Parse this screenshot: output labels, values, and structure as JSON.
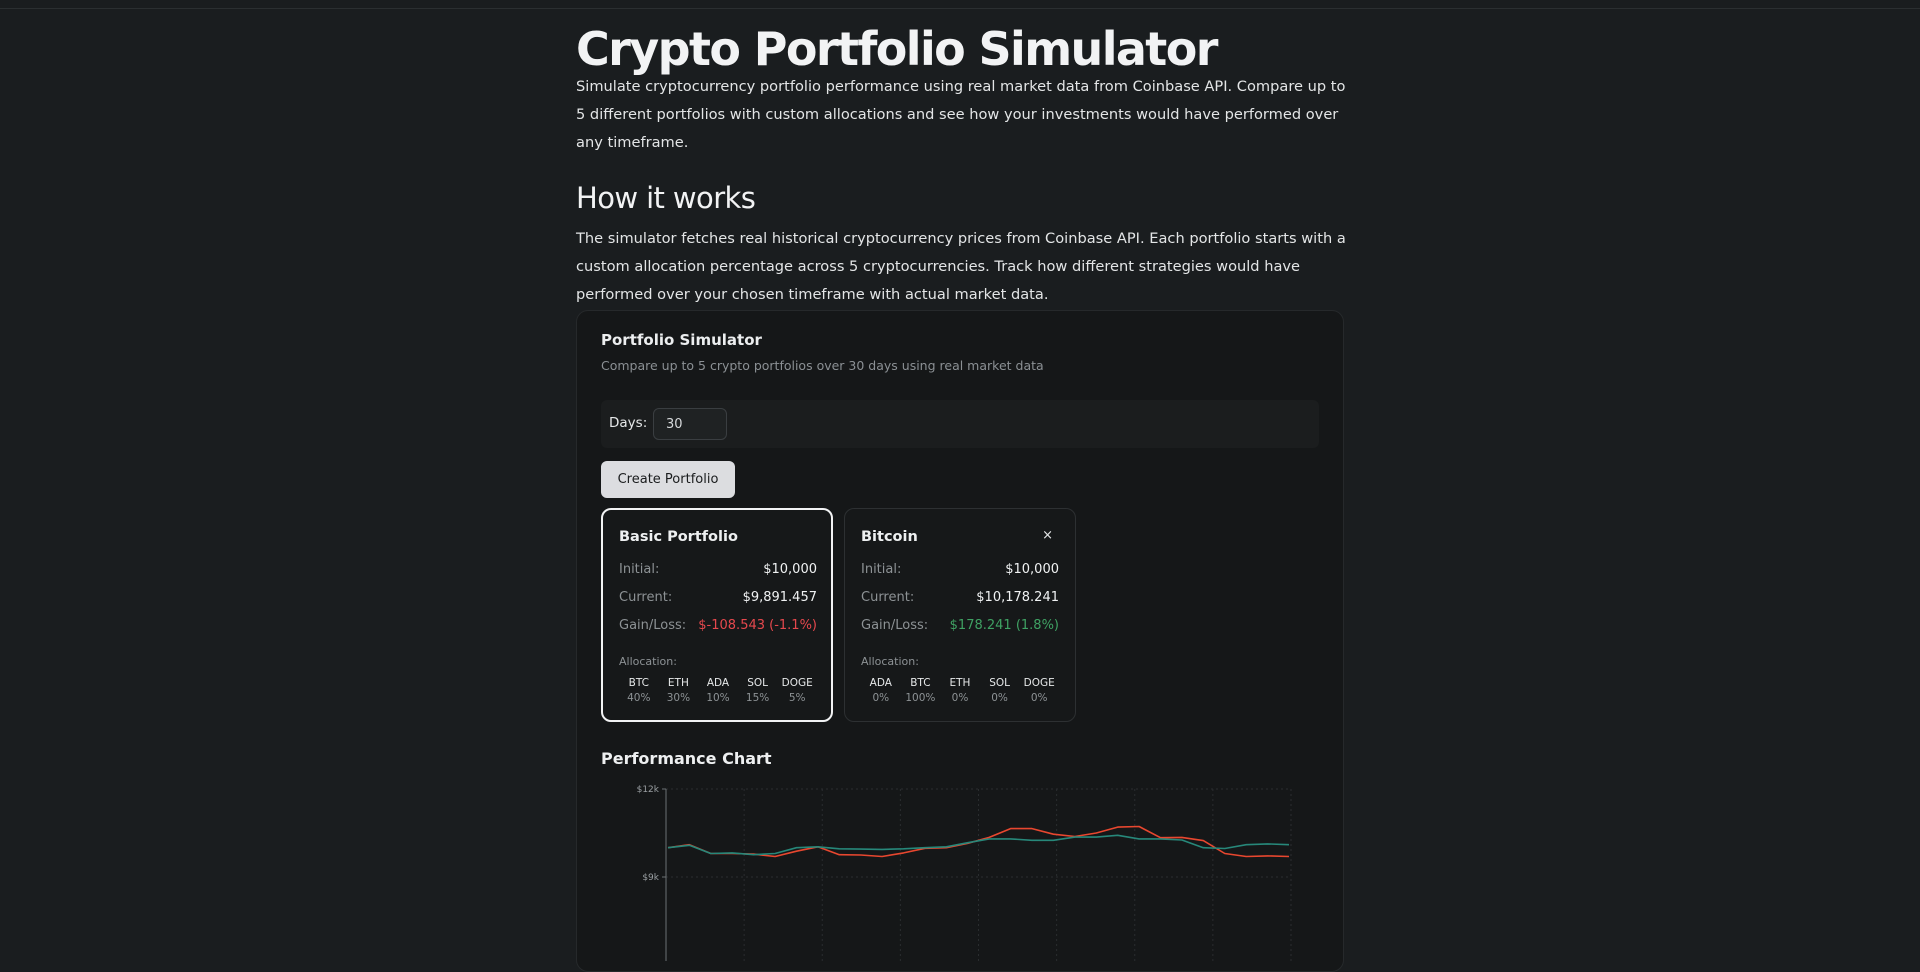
{
  "page": {
    "title": "Crypto Portfolio Simulator",
    "intro": "Simulate cryptocurrency portfolio performance using real market data from Coinbase API. Compare up to 5 different portfolios with custom allocations and see how your investments would have performed over any timeframe.",
    "how_heading": "How it works",
    "how_text": "The simulator fetches real historical cryptocurrency prices from Coinbase API. Each portfolio starts with a custom allocation percentage across 5 cryptocurrencies. Track how different strategies would have performed over your chosen timeframe with actual market data."
  },
  "simulator": {
    "title": "Portfolio Simulator",
    "subtitle": "Compare up to 5 crypto portfolios over 30 days using real market data",
    "days_label": "Days:",
    "days_value": "30",
    "create_button": "Create Portfolio",
    "close_symbol": "×",
    "labels": {
      "initial": "Initial:",
      "current": "Current:",
      "gain_loss": "Gain/Loss:",
      "allocation": "Allocation:"
    }
  },
  "portfolios": [
    {
      "name": "Basic Portfolio",
      "initial": "$10,000",
      "current": "$9,891.457",
      "gain_loss": "$-108.543 (-1.1%)",
      "allocation": [
        {
          "symbol": "BTC",
          "pct": "40%"
        },
        {
          "symbol": "ETH",
          "pct": "30%"
        },
        {
          "symbol": "ADA",
          "pct": "10%"
        },
        {
          "symbol": "SOL",
          "pct": "15%"
        },
        {
          "symbol": "DOGE",
          "pct": "5%"
        }
      ]
    },
    {
      "name": "Bitcoin",
      "initial": "$10,000",
      "current": "$10,178.241",
      "gain_loss": "$178.241 (1.8%)",
      "allocation": [
        {
          "symbol": "ADA",
          "pct": "0%"
        },
        {
          "symbol": "BTC",
          "pct": "100%"
        },
        {
          "symbol": "ETH",
          "pct": "0%"
        },
        {
          "symbol": "SOL",
          "pct": "0%"
        },
        {
          "symbol": "DOGE",
          "pct": "0%"
        }
      ]
    }
  ],
  "colors": {
    "loss": "#e5484d",
    "gain": "#3fa163",
    "series_basic": "#e8472f",
    "series_bitcoin": "#27887a"
  },
  "chart_title": "Performance Chart",
  "chart_data": {
    "type": "line",
    "title": "",
    "xlabel": "",
    "ylabel": "",
    "ylim": [
      8000,
      12000
    ],
    "y_ticks": [
      {
        "value": 12000,
        "label": "$12k"
      },
      {
        "value": 9000,
        "label": "$9k"
      }
    ],
    "grid": true,
    "x": [
      1,
      2,
      3,
      4,
      5,
      6,
      7,
      8,
      9,
      10,
      11,
      12,
      13,
      14,
      15,
      16,
      17,
      18,
      19,
      20,
      21,
      22,
      23,
      24,
      25,
      26,
      27,
      28,
      29,
      30
    ],
    "series": [
      {
        "color": "#e8472f",
        "values": [
          10000,
          10100,
          9800,
          9800,
          9780,
          9700,
          9880,
          10030,
          9760,
          9750,
          9700,
          9820,
          9980,
          10000,
          10150,
          10350,
          10650,
          10650,
          10460,
          10380,
          10500,
          10700,
          10720,
          10340,
          10350,
          10240,
          9800,
          9700,
          9720,
          9700
        ]
      },
      {
        "color": "#27887a",
        "values": [
          10000,
          10080,
          9800,
          9820,
          9760,
          9800,
          10000,
          10030,
          9960,
          9950,
          9940,
          9960,
          10000,
          10030,
          10170,
          10300,
          10300,
          10250,
          10250,
          10360,
          10360,
          10420,
          10300,
          10300,
          10260,
          10000,
          9970,
          10100,
          10130,
          10100
        ]
      }
    ]
  }
}
